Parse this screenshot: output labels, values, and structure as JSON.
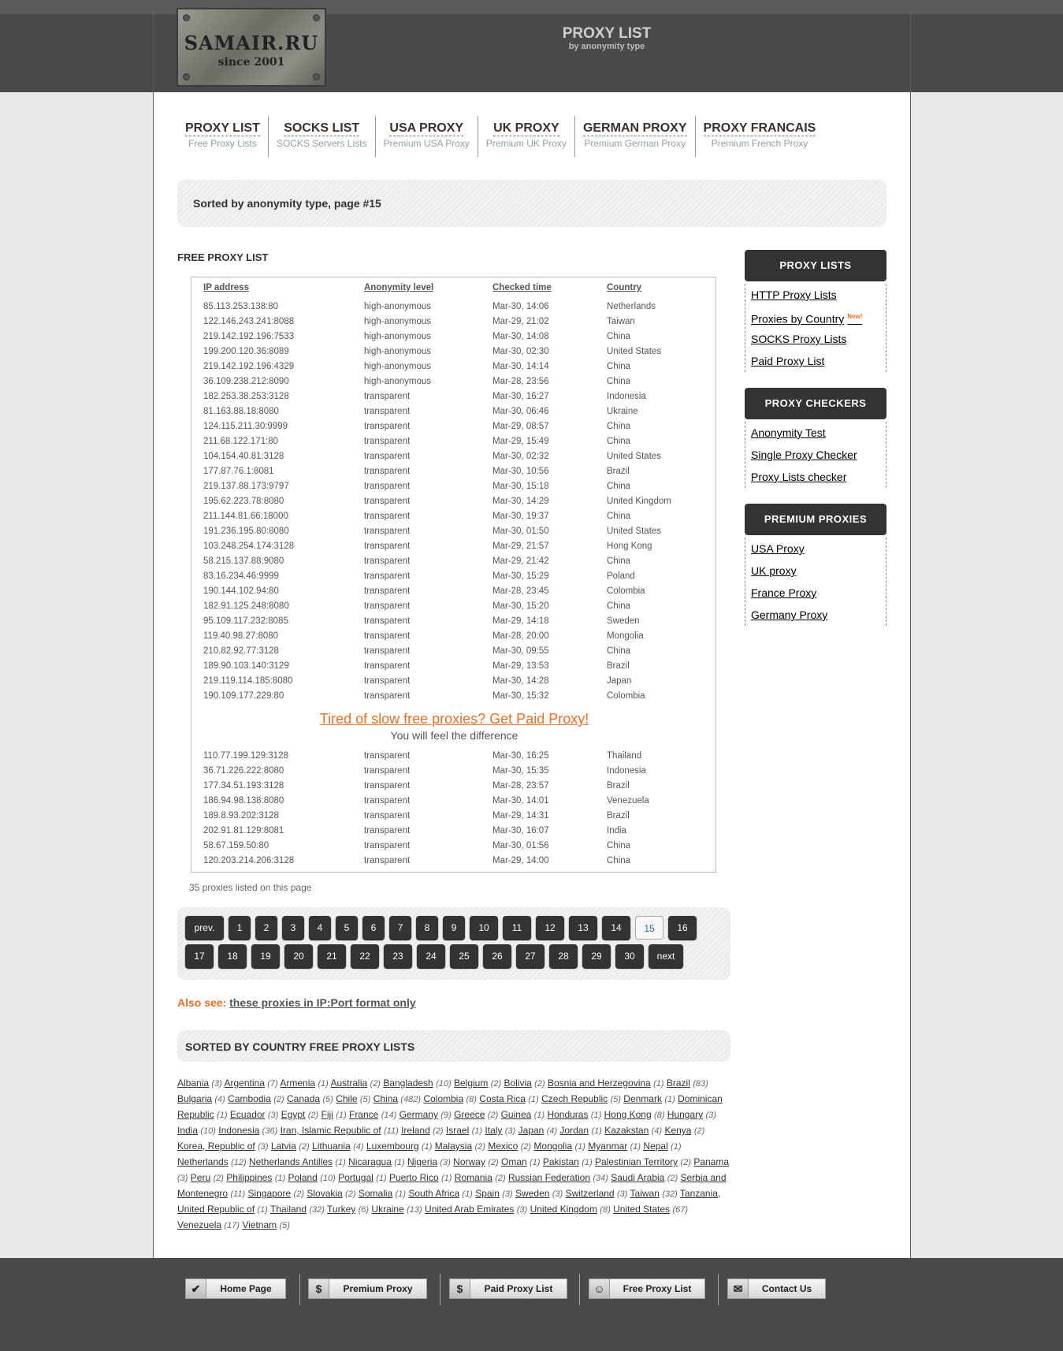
{
  "header": {
    "logo_line1": "SAMAIR.RU",
    "logo_line2": "since 2001",
    "title": "PROXY LIST",
    "subtitle": "by anonymity type"
  },
  "nav": [
    {
      "title": "PROXY LIST",
      "sub": "Free Proxy Lists"
    },
    {
      "title": "SOCKS LIST",
      "sub": "SOCKS Servers Lists"
    },
    {
      "title": "USA PROXY",
      "sub": "Premium USA Proxy"
    },
    {
      "title": "UK PROXY",
      "sub": "Premium UK Proxy"
    },
    {
      "title": "GERMAN PROXY",
      "sub": "Premium German Proxy"
    },
    {
      "title": "PROXY FRANCAIS",
      "sub": "Premium French Proxy"
    }
  ],
  "sort_heading": "Sorted by anonymity type, page #15",
  "section_title": "FREE PROXY LIST",
  "table": {
    "headers": [
      "IP address",
      "Anonymity level",
      "Checked time",
      "Country"
    ],
    "rows": [
      [
        "85.113.253.138:80",
        "high-anonymous",
        "Mar-30, 14:06",
        "Netherlands"
      ],
      [
        "122.146.243.241:8088",
        "high-anonymous",
        "Mar-29, 21:02",
        "Taiwan"
      ],
      [
        "219.142.192.196:7533",
        "high-anonymous",
        "Mar-30, 14:08",
        "China"
      ],
      [
        "199.200.120.36:8089",
        "high-anonymous",
        "Mar-30, 02:30",
        "United States"
      ],
      [
        "219.142.192.196:4329",
        "high-anonymous",
        "Mar-30, 14:14",
        "China"
      ],
      [
        "36.109.238.212:8090",
        "high-anonymous",
        "Mar-28, 23:56",
        "China"
      ],
      [
        "182.253.38.253:3128",
        "transparent",
        "Mar-30, 16:27",
        "Indonesia"
      ],
      [
        "81.163.88.18:8080",
        "transparent",
        "Mar-30, 06:46",
        "Ukraine"
      ],
      [
        "124.115.211.30:9999",
        "transparent",
        "Mar-29, 08:57",
        "China"
      ],
      [
        "211.68.122.171:80",
        "transparent",
        "Mar-29, 15:49",
        "China"
      ],
      [
        "104.154.40.81:3128",
        "transparent",
        "Mar-30, 02:32",
        "United States"
      ],
      [
        "177.87.76.1:8081",
        "transparent",
        "Mar-30, 10:56",
        "Brazil"
      ],
      [
        "219.137.88.173:9797",
        "transparent",
        "Mar-30, 15:18",
        "China"
      ],
      [
        "195.62.223.78:8080",
        "transparent",
        "Mar-30, 14:29",
        "United Kingdom"
      ],
      [
        "211.144.81.66:18000",
        "transparent",
        "Mar-30, 19:37",
        "China"
      ],
      [
        "191.236.195.80:8080",
        "transparent",
        "Mar-30, 01:50",
        "United States"
      ],
      [
        "103.248.254.174:3128",
        "transparent",
        "Mar-29, 21:57",
        "Hong Kong"
      ],
      [
        "58.215.137.88:9080",
        "transparent",
        "Mar-29, 21:42",
        "China"
      ],
      [
        "83.16.234.46:9999",
        "transparent",
        "Mar-30, 15:29",
        "Poland"
      ],
      [
        "190.144.102.94:80",
        "transparent",
        "Mar-28, 23:45",
        "Colombia"
      ],
      [
        "182.91.125.248:8080",
        "transparent",
        "Mar-30, 15:20",
        "China"
      ],
      [
        "95.109.117.232:8085",
        "transparent",
        "Mar-29, 14:18",
        "Sweden"
      ],
      [
        "119.40.98.27:8080",
        "transparent",
        "Mar-28, 20:00",
        "Mongolia"
      ],
      [
        "210.82.92.77:3128",
        "transparent",
        "Mar-30, 09:55",
        "China"
      ],
      [
        "189.90.103.140:3129",
        "transparent",
        "Mar-29, 13:53",
        "Brazil"
      ],
      [
        "219.119.114.185:8080",
        "transparent",
        "Mar-30, 14:28",
        "Japan"
      ],
      [
        "190.109.177.229:80",
        "transparent",
        "Mar-30, 15:32",
        "Colombia"
      ]
    ],
    "rows2": [
      [
        "110.77.199.129:3128",
        "transparent",
        "Mar-30, 16:25",
        "Thailand"
      ],
      [
        "36.71.226.222:8080",
        "transparent",
        "Mar-30, 15:35",
        "Indonesia"
      ],
      [
        "177.34.51.193:3128",
        "transparent",
        "Mar-28, 23:57",
        "Brazil"
      ],
      [
        "186.94.98.138:8080",
        "transparent",
        "Mar-30, 14:01",
        "Venezuela"
      ],
      [
        "189.8.93.202:3128",
        "transparent",
        "Mar-29, 14:31",
        "Brazil"
      ],
      [
        "202.91.81.129:8081",
        "transparent",
        "Mar-30, 16:07",
        "India"
      ],
      [
        "58.67.159.50:80",
        "transparent",
        "Mar-30, 01:56",
        "China"
      ],
      [
        "120.203.214.206:3128",
        "transparent",
        "Mar-29, 14:00",
        "China"
      ]
    ]
  },
  "ad": {
    "headline": "Tired of slow free proxies? Get Paid Proxy!",
    "sub": "You will feel the difference"
  },
  "count_text": "35 proxies listed on this page",
  "pager": {
    "prev": "prev.",
    "next": "next",
    "current": "15",
    "pages": [
      "1",
      "2",
      "3",
      "4",
      "5",
      "6",
      "7",
      "8",
      "9",
      "10",
      "11",
      "12",
      "13",
      "14",
      "15",
      "16",
      "17",
      "18",
      "19",
      "20",
      "21",
      "22",
      "23",
      "24",
      "25",
      "26",
      "27",
      "28",
      "29",
      "30"
    ]
  },
  "also_see": {
    "label": "Also see:",
    "link": "these proxies in IP:Port format only"
  },
  "country_title": "SORTED BY COUNTRY FREE PROXY LISTS",
  "countries": [
    [
      "Albania",
      "(3)"
    ],
    [
      "Argentina",
      "(7)"
    ],
    [
      "Armenia",
      "(1)"
    ],
    [
      "Australia",
      "(2)"
    ],
    [
      "Bangladesh",
      "(10)"
    ],
    [
      "Belgium",
      "(2)"
    ],
    [
      "Bolivia",
      "(2)"
    ],
    [
      "Bosnia and Herzegovina",
      "(1)"
    ],
    [
      "Brazil",
      "(83)"
    ],
    [
      "Bulgaria",
      "(4)"
    ],
    [
      "Cambodia",
      "(2)"
    ],
    [
      "Canada",
      "(5)"
    ],
    [
      "Chile",
      "(5)"
    ],
    [
      "China",
      "(482)"
    ],
    [
      "Colombia",
      "(8)"
    ],
    [
      "Costa Rica",
      "(1)"
    ],
    [
      "Czech Republic",
      "(5)"
    ],
    [
      "Denmark",
      "(1)"
    ],
    [
      "Dominican Republic",
      "(1)"
    ],
    [
      "Ecuador",
      "(3)"
    ],
    [
      "Egypt",
      "(2)"
    ],
    [
      "Fiji",
      "(1)"
    ],
    [
      "France",
      "(14)"
    ],
    [
      "Germany",
      "(9)"
    ],
    [
      "Greece",
      "(2)"
    ],
    [
      "Guinea",
      "(1)"
    ],
    [
      "Honduras",
      "(1)"
    ],
    [
      "Hong Kong",
      "(8)"
    ],
    [
      "Hungary",
      "(3)"
    ],
    [
      "India",
      "(10)"
    ],
    [
      "Indonesia",
      "(36)"
    ],
    [
      "Iran, Islamic Republic of",
      "(11)"
    ],
    [
      "Ireland",
      "(2)"
    ],
    [
      "Israel",
      "(1)"
    ],
    [
      "Italy",
      "(3)"
    ],
    [
      "Japan",
      "(4)"
    ],
    [
      "Jordan",
      "(1)"
    ],
    [
      "Kazakstan",
      "(4)"
    ],
    [
      "Kenya",
      "(2)"
    ],
    [
      "Korea, Republic of",
      "(3)"
    ],
    [
      "Latvia",
      "(2)"
    ],
    [
      "Lithuania",
      "(4)"
    ],
    [
      "Luxembourg",
      "(1)"
    ],
    [
      "Malaysia",
      "(2)"
    ],
    [
      "Mexico",
      "(2)"
    ],
    [
      "Mongolia",
      "(1)"
    ],
    [
      "Myanmar",
      "(1)"
    ],
    [
      "Nepal",
      "(1)"
    ],
    [
      "Netherlands",
      "(12)"
    ],
    [
      "Netherlands Antilles",
      "(1)"
    ],
    [
      "Nicaragua",
      "(1)"
    ],
    [
      "Nigeria",
      "(3)"
    ],
    [
      "Norway",
      "(2)"
    ],
    [
      "Oman",
      "(1)"
    ],
    [
      "Pakistan",
      "(1)"
    ],
    [
      "Palestinian Territory",
      "(2)"
    ],
    [
      "Panama",
      "(3)"
    ],
    [
      "Peru",
      "(2)"
    ],
    [
      "Philippines",
      "(1)"
    ],
    [
      "Poland",
      "(10)"
    ],
    [
      "Portugal",
      "(1)"
    ],
    [
      "Puerto Rico",
      "(1)"
    ],
    [
      "Romania",
      "(2)"
    ],
    [
      "Russian Federation",
      "(34)"
    ],
    [
      "Saudi Arabia",
      "(2)"
    ],
    [
      "Serbia and Montenegro",
      "(11)"
    ],
    [
      "Singapore",
      "(2)"
    ],
    [
      "Slovakia",
      "(2)"
    ],
    [
      "Somalia",
      "(1)"
    ],
    [
      "South Africa",
      "(1)"
    ],
    [
      "Spain",
      "(3)"
    ],
    [
      "Sweden",
      "(3)"
    ],
    [
      "Switzerland",
      "(3)"
    ],
    [
      "Taiwan",
      "(32)"
    ],
    [
      "Tanzania, United Republic of",
      "(1)"
    ],
    [
      "Thailand",
      "(32)"
    ],
    [
      "Turkey",
      "(6)"
    ],
    [
      "Ukraine",
      "(13)"
    ],
    [
      "United Arab Emirates",
      "(3)"
    ],
    [
      "United Kingdom",
      "(8)"
    ],
    [
      "United States",
      "(67)"
    ],
    [
      "Venezuela",
      "(17)"
    ],
    [
      "Vietnam",
      "(5)"
    ]
  ],
  "sidebar": [
    {
      "title": "PROXY LISTS",
      "links": [
        "HTTP Proxy Lists",
        "Proxies by Country",
        "SOCKS Proxy Lists",
        "Paid Proxy List"
      ],
      "badge": "New!"
    },
    {
      "title": "PROXY CHECKERS",
      "links": [
        "Anonymity Test",
        "Single Proxy Checker",
        "Proxy Lists checker"
      ]
    },
    {
      "title": "PREMIUM PROXIES",
      "links": [
        "USA Proxy",
        "UK proxy",
        "France Proxy",
        "Germany Proxy"
      ]
    }
  ],
  "footer": [
    {
      "label": "Home Page",
      "icon": "check-icon"
    },
    {
      "label": "Premium Proxy",
      "icon": "dollar-icon"
    },
    {
      "label": "Paid Proxy List",
      "icon": "dollar-icon"
    },
    {
      "label": "Free Proxy List",
      "icon": "smiley-icon"
    },
    {
      "label": "Contact Us",
      "icon": "envelope-icon"
    }
  ],
  "colors": {
    "accent": "#ec6f25",
    "dark": "#333333",
    "header": "#4a4a4a",
    "link_sub": "#8ca0aa"
  }
}
